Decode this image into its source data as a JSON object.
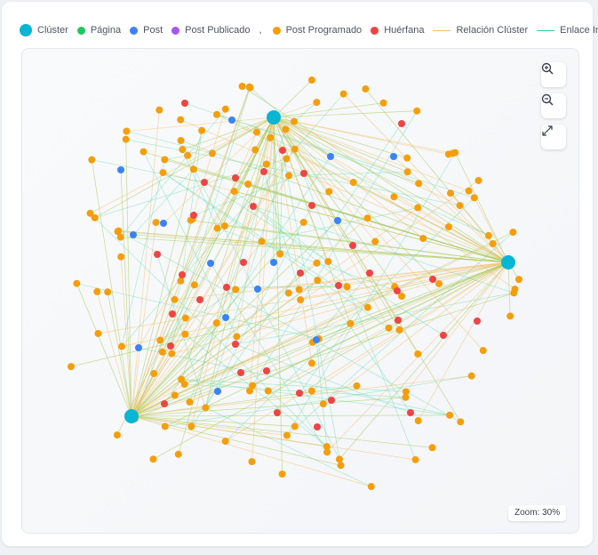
{
  "legend": {
    "cluster": {
      "label": "Clúster",
      "color": "#06b6d4"
    },
    "page": {
      "label": "Página",
      "color": "#22c55e"
    },
    "post": {
      "label": "Post",
      "color": "#3b82f6"
    },
    "post_published": {
      "label": "Post Publicado",
      "color": "#a855f7"
    },
    "separator": ",",
    "post_scheduled": {
      "label": "Post Programado",
      "color": "#f59e0b"
    },
    "orphan": {
      "label": "Huérfana",
      "color": "#ef4444"
    },
    "cluster_relation": {
      "label": "Relación Clúster",
      "color": "#f5c06a"
    },
    "internal_link": {
      "label": "Enlace Interno",
      "color": "#34d399"
    }
  },
  "controls": {
    "zoom_in_icon": "zoom-in-icon",
    "zoom_out_icon": "zoom-out-icon",
    "fullscreen_icon": "expand-icon"
  },
  "zoom": {
    "label": "Zoom: 30%",
    "value_percent": 30
  }
}
